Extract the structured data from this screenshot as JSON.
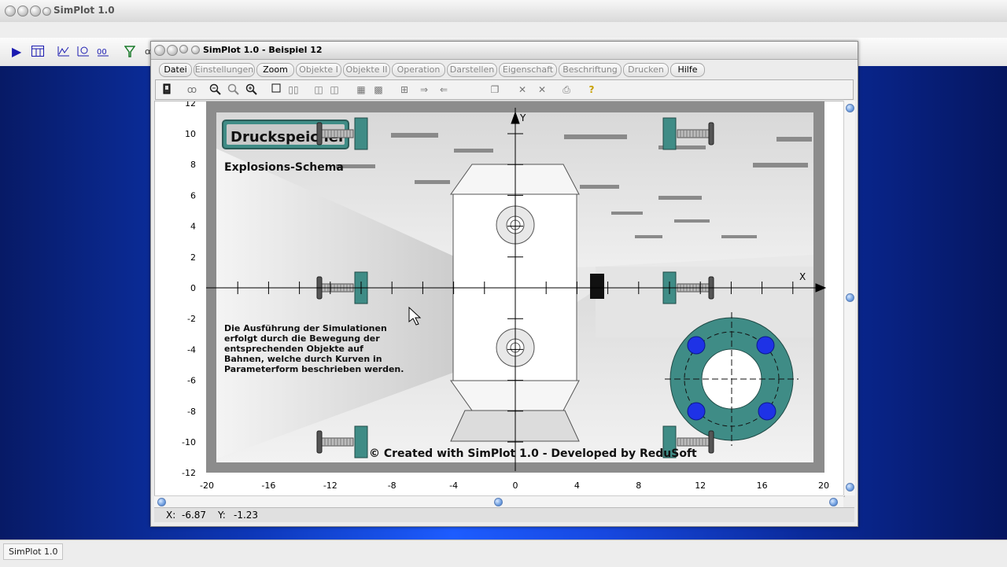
{
  "main_window": {
    "title": "SimPlot 1.0",
    "taskbar_label": "SimPlot 1.0"
  },
  "doc_window": {
    "title": "SimPlot 1.0 - Beispiel 12"
  },
  "menu": [
    {
      "label": "Datei",
      "enabled": true
    },
    {
      "label": "Einstellungen",
      "enabled": false
    },
    {
      "label": "Zoom",
      "enabled": true
    },
    {
      "label": "Objekte I",
      "enabled": false
    },
    {
      "label": "Objekte II",
      "enabled": false
    },
    {
      "label": "Operation",
      "enabled": false
    },
    {
      "label": "Darstellen",
      "enabled": false
    },
    {
      "label": "Eigenschaft",
      "enabled": false
    },
    {
      "label": "Beschriftung",
      "enabled": false
    },
    {
      "label": "Drucken",
      "enabled": false
    },
    {
      "label": "Hilfe",
      "enabled": true
    }
  ],
  "toolbar_icons": [
    "run-icon",
    "table-icon",
    "graph-icon",
    "parametric-icon",
    "function-icon",
    "filter-icon"
  ],
  "doc_toolbar_icons": [
    "device-icon",
    "glasses-icon",
    "zoom-out-icon",
    "zoom-icon",
    "zoom-in-icon",
    "rectangle-icon",
    "dual-rect-icon",
    "frame-icon",
    "frame2-icon",
    "grid-icon",
    "copy-grid-icon",
    "arrange-icon",
    "arrow-right-icon",
    "arrow-left-icon",
    "pages-icon",
    "cross-icon",
    "cross2-icon",
    "print-icon",
    "help-icon"
  ],
  "plot": {
    "title_box": "Druckspeicher",
    "subtitle": "Explosions-Schema",
    "description": [
      "Die Ausführung der Simulationen",
      "erfolgt durch die Bewegung der",
      "entsprechenden Objekte auf",
      "Bahnen, welche durch Kurven in",
      "Parameterform beschrieben werden."
    ],
    "copyright": "© Created with SimPlot 1.0 - Developed by ReduSoft",
    "x_axis_label": "X",
    "y_axis_label": "Y",
    "x_ticks": [
      "-20",
      "-16",
      "-12",
      "-8",
      "-4",
      "0",
      "4",
      "8",
      "12",
      "16",
      "20"
    ],
    "y_ticks": [
      "12",
      "10",
      "8",
      "6",
      "4",
      "2",
      "0",
      "-2",
      "-4",
      "-6",
      "-8",
      "-10",
      "-12"
    ],
    "colors": {
      "teal": "#3f8c86",
      "blue_dot": "#1e32e6",
      "frame": "#8c8c8c"
    }
  },
  "status": {
    "x_label": "X:",
    "x_value": "-6.87",
    "y_label": "Y:",
    "y_value": "-1.23"
  }
}
